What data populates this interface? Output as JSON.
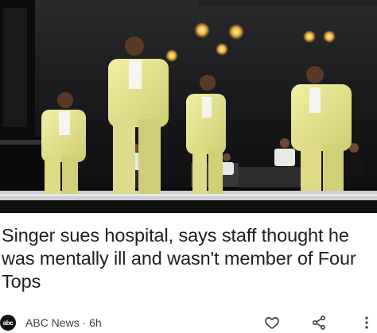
{
  "article": {
    "headline": "Singer sues hospital, says staff thought he was mentally ill and wasn't member of Four Tops",
    "source": "ABC News",
    "age": "6h",
    "source_logo_text": "abc"
  },
  "icons": {
    "like": "heart-outline-icon",
    "share": "share-icon",
    "more": "more-vert-icon"
  },
  "colors": {
    "text": "#1f1f1f",
    "meta_text": "#3c3c3c",
    "suit": "#e6e48a",
    "stage_bg": "#1b1b1d"
  }
}
